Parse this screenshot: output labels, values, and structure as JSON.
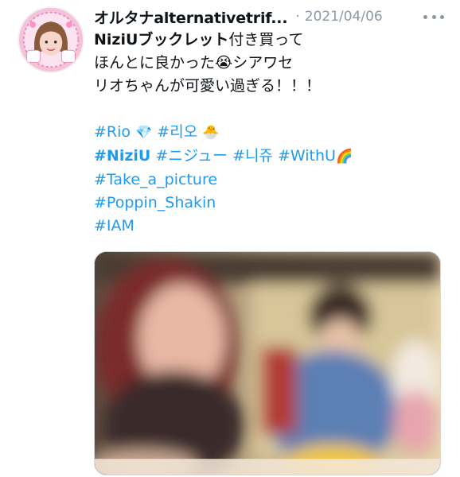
{
  "tweet": {
    "display_name": "オルタナalternativetrif...",
    "separator": "·",
    "date": "2021/04/06",
    "text_line_1_bold": "NiziUブックレット",
    "text_line_1_rest": "付き買って",
    "text_line_2": "ほんとに良かった😭シアワセ",
    "text_line_3": "リオちゃんが可愛い過ぎる！！！",
    "hashtag_rio": "#Rio",
    "emoji_gem": "💎",
    "hashtag_rio_kr": "#리오",
    "emoji_chick": "🐣",
    "hashtag_niziu": "#NiziU",
    "hashtag_niziu_jp": "#ニジュー",
    "hashtag_niziu_kr": "#니쥬",
    "hashtag_withu": "#WithU",
    "emoji_rainbow": "🌈",
    "hashtag_take_a_picture": "#Take_a_picture",
    "hashtag_poppin_shakin": "#Poppin_Shakin",
    "hashtag_iam": "#IAM"
  },
  "icons": {
    "more": "more-horizontal-icon",
    "avatar": "profile-avatar"
  },
  "colors": {
    "link": "#1d9bf0",
    "secondary_text": "#8b98a5",
    "primary_text": "#0f1419"
  }
}
